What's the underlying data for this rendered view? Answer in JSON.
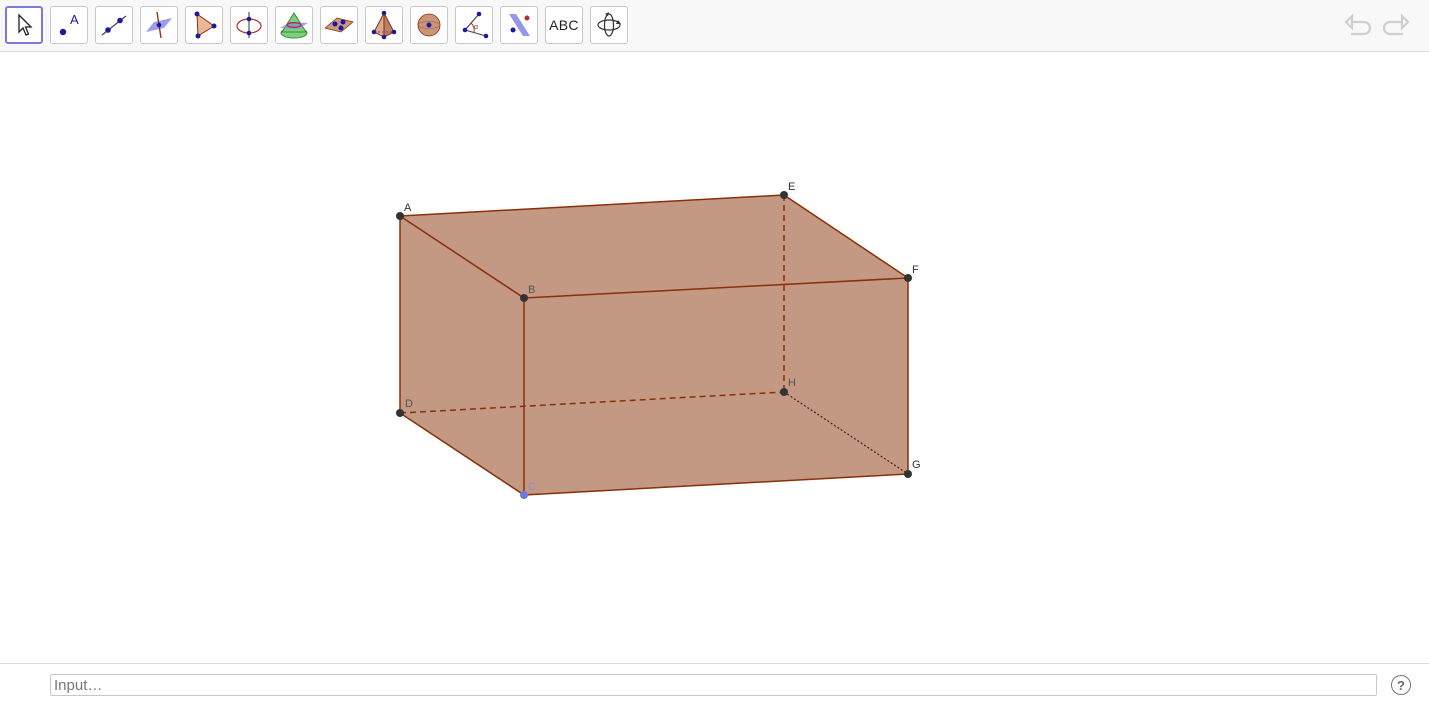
{
  "toolbar": {
    "tools": [
      {
        "name": "move-tool",
        "icon": "arrow-cursor-icon",
        "selected": true
      },
      {
        "name": "point-tool",
        "icon": "point-icon",
        "label": "A"
      },
      {
        "name": "line-tool",
        "icon": "line-through-points-icon"
      },
      {
        "name": "perpendicular-tool",
        "icon": "perpendicular-line-icon"
      },
      {
        "name": "polygon-tool",
        "icon": "polygon-icon"
      },
      {
        "name": "circle-axis-tool",
        "icon": "circle-with-axis-icon"
      },
      {
        "name": "intersect-surfaces-tool",
        "icon": "intersect-surfaces-icon"
      },
      {
        "name": "plane-tool",
        "icon": "plane-through-points-icon"
      },
      {
        "name": "pyramid-tool",
        "icon": "pyramid-icon"
      },
      {
        "name": "sphere-tool",
        "icon": "sphere-icon"
      },
      {
        "name": "angle-tool",
        "icon": "angle-icon"
      },
      {
        "name": "reflect-tool",
        "icon": "reflect-about-plane-icon"
      },
      {
        "name": "text-tool",
        "icon": "text-icon",
        "label": "ABC"
      },
      {
        "name": "rotate-view-tool",
        "icon": "rotate-3d-view-icon"
      }
    ],
    "undo_icon": "undo-icon",
    "redo_icon": "redo-icon"
  },
  "points": {
    "A": "A",
    "B": "B",
    "C": "C",
    "D": "D",
    "E": "E",
    "F": "F",
    "G": "G",
    "H": "H"
  },
  "colors": {
    "face": "#b0785a",
    "edge": "#8b2f08",
    "point": "#333333",
    "selected_point": "#6b78e0",
    "tool_selected_border": "#7b7bd9"
  },
  "input_bar": {
    "placeholder": "Input…",
    "help_label": "?"
  }
}
